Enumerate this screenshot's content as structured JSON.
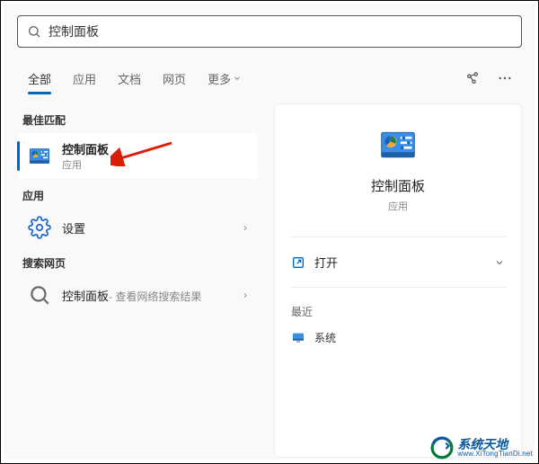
{
  "search": {
    "query": "控制面板"
  },
  "tabs": {
    "all": "全部",
    "apps": "应用",
    "docs": "文档",
    "web": "网页",
    "more": "更多"
  },
  "sections": {
    "best_match": "最佳匹配",
    "apps": "应用",
    "search_web": "搜索网页"
  },
  "best_match": {
    "title": "控制面板",
    "subtitle": "应用"
  },
  "apps_list": {
    "item1": {
      "title": "设置"
    }
  },
  "web_list": {
    "item1": {
      "title": "控制面板",
      "suffix": " - 查看网络搜索结果"
    }
  },
  "preview": {
    "title": "控制面板",
    "subtitle": "应用",
    "open": "打开",
    "recent_header": "最近",
    "recent_item1": "系统"
  },
  "watermark": {
    "cn": "系统天地",
    "en": "www.XiTongTianDi.net"
  }
}
